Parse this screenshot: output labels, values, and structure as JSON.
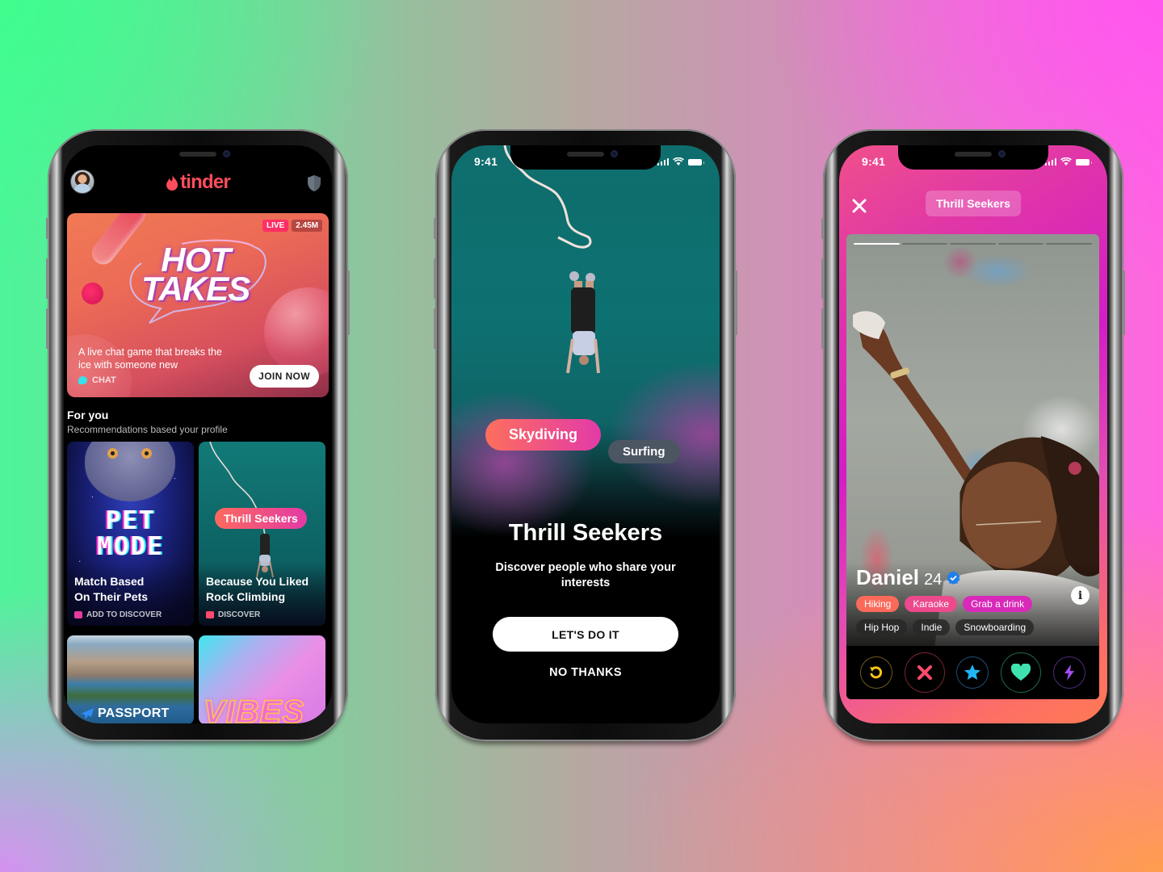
{
  "colors": {
    "tinder_red": "#fe4d5c",
    "pill_gradient_start": "#fd6f5d",
    "pill_gradient_end": "#e33aa8",
    "surf_chip": "#4c5663",
    "live_badge": "#ff2f64",
    "rewind": "#f5c518",
    "nope": "#ff4a6b",
    "super_like": "#22b5f5",
    "like": "#3ee3b0",
    "boost": "#a54cf5"
  },
  "phones": {
    "home": {
      "header": {
        "logo_text": "tinder",
        "avatar": "profile-avatar",
        "right_icon": "shield-icon"
      },
      "featured": {
        "title_line1": "HOT",
        "title_line2": "TAKES",
        "live_label": "LIVE",
        "viewers": "2.45M",
        "description": "A live chat game that breaks the ice with someone new",
        "category": "CHAT",
        "cta": "JOIN NOW"
      },
      "for_you": {
        "title": "For you",
        "subtitle": "Recommendations based your profile",
        "tiles": [
          {
            "art_text_line1": "PET",
            "art_text_line2": "MODE",
            "caption_line1": "Match Based",
            "caption_line2": "On Their Pets",
            "footer": "ADD TO DISCOVER"
          },
          {
            "pill": "Thrill Seekers",
            "caption_line1": "Because You Liked",
            "caption_line2": "Rock Climbing",
            "footer": "DISCOVER"
          },
          {
            "label": "PASSPORT"
          },
          {
            "art_text": "VIBES"
          }
        ]
      }
    },
    "intro": {
      "status_time": "9:41",
      "chips": [
        "Skydiving",
        "Surfing"
      ],
      "title": "Thrill Seekers",
      "subtitle": "Discover people who share your interests",
      "primary_cta": "LET'S DO IT",
      "secondary_cta": "NO THANKS"
    },
    "profile": {
      "status_time": "9:41",
      "category_chip": "Thrill Seekers",
      "photo_count": 5,
      "current_photo": 1,
      "name": "Daniel",
      "age": "24",
      "verified": true,
      "shared_tags": [
        {
          "label": "Hiking",
          "color": "#fa6a5a"
        },
        {
          "label": "Karaoke",
          "color": "#ec4a8c"
        },
        {
          "label": "Grab a drink",
          "color": "#d929b8"
        }
      ],
      "other_tags": [
        "Hip Hop",
        "Indie",
        "Snowboarding"
      ],
      "actions": [
        "rewind",
        "nope",
        "super-like",
        "like",
        "boost"
      ]
    }
  }
}
